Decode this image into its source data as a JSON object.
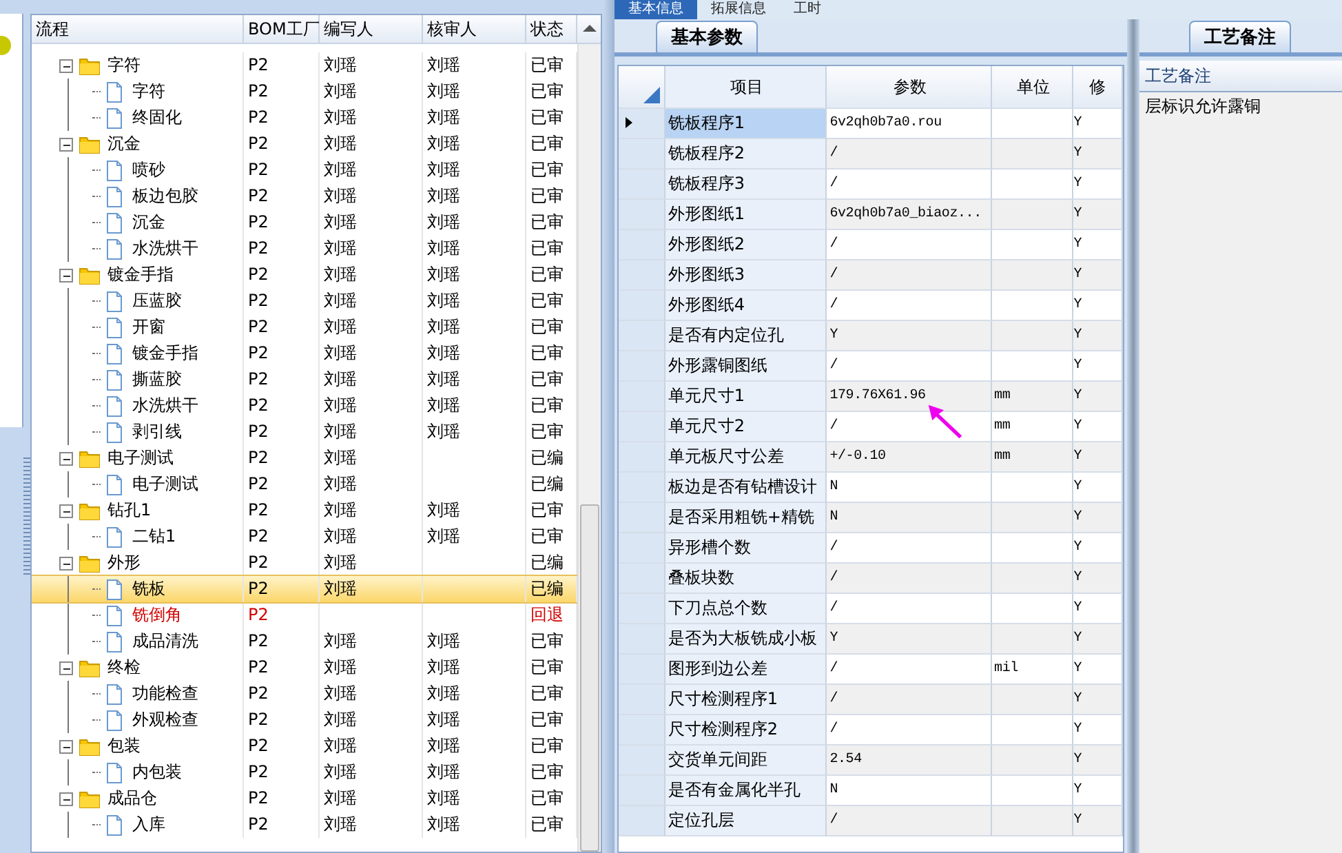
{
  "top_tabs": [
    {
      "label": "基本信息",
      "selected": true
    },
    {
      "label": "拓展信息",
      "selected": false
    },
    {
      "label": "工时",
      "selected": false
    }
  ],
  "flow_tree": {
    "columns": [
      "流程",
      "BOM工厂",
      "编写人",
      "核审人",
      "状态"
    ],
    "rows": [
      {
        "name": "字符",
        "kind": "folder",
        "expanded": true,
        "bom": "P2",
        "writer": "刘瑶",
        "reviewer": "刘瑶",
        "status": "已审",
        "selected": false,
        "returned": false,
        "children": [
          {
            "name": "字符",
            "kind": "file",
            "bom": "P2",
            "writer": "刘瑶",
            "reviewer": "刘瑶",
            "status": "已审",
            "selected": false,
            "returned": false
          },
          {
            "name": "终固化",
            "kind": "file",
            "bom": "P2",
            "writer": "刘瑶",
            "reviewer": "刘瑶",
            "status": "已审",
            "selected": false,
            "returned": false
          }
        ]
      },
      {
        "name": "沉金",
        "kind": "folder",
        "expanded": true,
        "bom": "P2",
        "writer": "刘瑶",
        "reviewer": "刘瑶",
        "status": "已审",
        "selected": false,
        "returned": false,
        "children": [
          {
            "name": "喷砂",
            "kind": "file",
            "bom": "P2",
            "writer": "刘瑶",
            "reviewer": "刘瑶",
            "status": "已审",
            "selected": false,
            "returned": false
          },
          {
            "name": "板边包胶",
            "kind": "file",
            "bom": "P2",
            "writer": "刘瑶",
            "reviewer": "刘瑶",
            "status": "已审",
            "selected": false,
            "returned": false
          },
          {
            "name": "沉金",
            "kind": "file",
            "bom": "P2",
            "writer": "刘瑶",
            "reviewer": "刘瑶",
            "status": "已审",
            "selected": false,
            "returned": false
          },
          {
            "name": "水洗烘干",
            "kind": "file",
            "bom": "P2",
            "writer": "刘瑶",
            "reviewer": "刘瑶",
            "status": "已审",
            "selected": false,
            "returned": false
          }
        ]
      },
      {
        "name": "镀金手指",
        "kind": "folder",
        "expanded": true,
        "bom": "P2",
        "writer": "刘瑶",
        "reviewer": "刘瑶",
        "status": "已审",
        "selected": false,
        "returned": false,
        "children": [
          {
            "name": "压蓝胶",
            "kind": "file",
            "bom": "P2",
            "writer": "刘瑶",
            "reviewer": "刘瑶",
            "status": "已审",
            "selected": false,
            "returned": false
          },
          {
            "name": "开窗",
            "kind": "file",
            "bom": "P2",
            "writer": "刘瑶",
            "reviewer": "刘瑶",
            "status": "已审",
            "selected": false,
            "returned": false
          },
          {
            "name": "镀金手指",
            "kind": "file",
            "bom": "P2",
            "writer": "刘瑶",
            "reviewer": "刘瑶",
            "status": "已审",
            "selected": false,
            "returned": false
          },
          {
            "name": "撕蓝胶",
            "kind": "file",
            "bom": "P2",
            "writer": "刘瑶",
            "reviewer": "刘瑶",
            "status": "已审",
            "selected": false,
            "returned": false
          },
          {
            "name": "水洗烘干",
            "kind": "file",
            "bom": "P2",
            "writer": "刘瑶",
            "reviewer": "刘瑶",
            "status": "已审",
            "selected": false,
            "returned": false
          },
          {
            "name": "剥引线",
            "kind": "file",
            "bom": "P2",
            "writer": "刘瑶",
            "reviewer": "刘瑶",
            "status": "已审",
            "selected": false,
            "returned": false
          }
        ]
      },
      {
        "name": "电子测试",
        "kind": "folder",
        "expanded": true,
        "bom": "P2",
        "writer": "刘瑶",
        "status": "已编",
        "selected": false,
        "returned": false,
        "children": [
          {
            "name": "电子测试",
            "kind": "file",
            "bom": "P2",
            "writer": "刘瑶",
            "status": "已编",
            "selected": false,
            "returned": false
          }
        ]
      },
      {
        "name": "钻孔1",
        "kind": "folder",
        "expanded": true,
        "bom": "P2",
        "writer": "刘瑶",
        "reviewer": "刘瑶",
        "status": "已审",
        "selected": false,
        "returned": false,
        "children": [
          {
            "name": "二钻1",
            "kind": "file",
            "bom": "P2",
            "writer": "刘瑶",
            "reviewer": "刘瑶",
            "status": "已审",
            "selected": false,
            "returned": false
          }
        ]
      },
      {
        "name": "外形",
        "kind": "folder",
        "expanded": true,
        "bom": "P2",
        "writer": "刘瑶",
        "status": "已编",
        "selected": false,
        "returned": false,
        "children": [
          {
            "name": "铣板",
            "kind": "file",
            "bom": "P2",
            "writer": "刘瑶",
            "status": "已编",
            "selected": true,
            "returned": false
          },
          {
            "name": "铣倒角",
            "kind": "file",
            "bom": "P2",
            "status": "回退",
            "selected": false,
            "returned": true
          },
          {
            "name": "成品清洗",
            "kind": "file",
            "bom": "P2",
            "writer": "刘瑶",
            "reviewer": "刘瑶",
            "status": "已审",
            "selected": false,
            "returned": false
          }
        ]
      },
      {
        "name": "终检",
        "kind": "folder",
        "expanded": true,
        "bom": "P2",
        "writer": "刘瑶",
        "reviewer": "刘瑶",
        "status": "已审",
        "selected": false,
        "returned": false,
        "children": [
          {
            "name": "功能检查",
            "kind": "file",
            "bom": "P2",
            "writer": "刘瑶",
            "reviewer": "刘瑶",
            "status": "已审",
            "selected": false,
            "returned": false
          },
          {
            "name": "外观检查",
            "kind": "file",
            "bom": "P2",
            "writer": "刘瑶",
            "reviewer": "刘瑶",
            "status": "已审",
            "selected": false,
            "returned": false
          }
        ]
      },
      {
        "name": "包装",
        "kind": "folder",
        "expanded": true,
        "bom": "P2",
        "writer": "刘瑶",
        "reviewer": "刘瑶",
        "status": "已审",
        "selected": false,
        "returned": false,
        "children": [
          {
            "name": "内包装",
            "kind": "file",
            "bom": "P2",
            "writer": "刘瑶",
            "reviewer": "刘瑶",
            "status": "已审",
            "selected": false,
            "returned": false
          }
        ]
      },
      {
        "name": "成品仓",
        "kind": "folder",
        "expanded": true,
        "bom": "P2",
        "writer": "刘瑶",
        "reviewer": "刘瑶",
        "status": "已审",
        "selected": false,
        "returned": false,
        "children": [
          {
            "name": "入库",
            "kind": "file",
            "bom": "P2",
            "writer": "刘瑶",
            "reviewer": "刘瑶",
            "status": "已审",
            "selected": false,
            "returned": false
          }
        ]
      }
    ]
  },
  "params_tab": {
    "label": "基本参数",
    "selected": true
  },
  "params_grid": {
    "columns": [
      "项目",
      "参数",
      "单位",
      "修"
    ],
    "rows": [
      {
        "item": "铣板程序1",
        "value": "6v2qh0b7a0.rou",
        "modify": "Y",
        "current": true
      },
      {
        "item": "铣板程序2",
        "value": "/",
        "modify": "Y",
        "current": false
      },
      {
        "item": "铣板程序3",
        "value": "/",
        "modify": "Y",
        "current": false
      },
      {
        "item": "外形图纸1",
        "value": "6v2qh0b7a0_biaoz...",
        "modify": "Y",
        "current": false
      },
      {
        "item": "外形图纸2",
        "value": "/",
        "modify": "Y",
        "current": false
      },
      {
        "item": "外形图纸3",
        "value": "/",
        "modify": "Y",
        "current": false
      },
      {
        "item": "外形图纸4",
        "value": "/",
        "modify": "Y",
        "current": false
      },
      {
        "item": "是否有内定位孔",
        "value": "Y",
        "modify": "Y",
        "current": false
      },
      {
        "item": "外形露铜图纸",
        "value": "/",
        "modify": "Y",
        "current": false
      },
      {
        "item": "单元尺寸1",
        "value": "179.76X61.96",
        "unit": "mm",
        "modify": "Y",
        "current": false
      },
      {
        "item": "单元尺寸2",
        "value": "/",
        "unit": "mm",
        "modify": "Y",
        "current": false
      },
      {
        "item": "单元板尺寸公差",
        "value": "+/-0.10",
        "unit": "mm",
        "modify": "Y",
        "current": false
      },
      {
        "item": "板边是否有钻槽设计",
        "value": "N",
        "modify": "Y",
        "current": false
      },
      {
        "item": "是否采用粗铣+精铣",
        "value": "N",
        "modify": "Y",
        "current": false
      },
      {
        "item": "异形槽个数",
        "value": "/",
        "modify": "Y",
        "current": false
      },
      {
        "item": "叠板块数",
        "value": "/",
        "modify": "Y",
        "current": false
      },
      {
        "item": "下刀点总个数",
        "value": "/",
        "modify": "Y",
        "current": false
      },
      {
        "item": "是否为大板铣成小板",
        "value": "Y",
        "modify": "Y",
        "current": false
      },
      {
        "item": "图形到边公差",
        "value": "/",
        "unit": "mil",
        "modify": "Y",
        "current": false
      },
      {
        "item": "尺寸检测程序1",
        "value": "/",
        "modify": "Y",
        "current": false
      },
      {
        "item": "尺寸检测程序2",
        "value": "/",
        "modify": "Y",
        "current": false
      },
      {
        "item": "交货单元间距",
        "value": "2.54",
        "modify": "Y",
        "current": false
      },
      {
        "item": "是否有金属化半孔",
        "value": "N",
        "modify": "Y",
        "current": false
      },
      {
        "item": "定位孔层",
        "value": "/",
        "modify": "Y",
        "current": false
      }
    ]
  },
  "notes_tab": {
    "label": "工艺备注",
    "selected": true
  },
  "notes": {
    "header": "工艺备注",
    "text": "层标识允许露铜"
  }
}
